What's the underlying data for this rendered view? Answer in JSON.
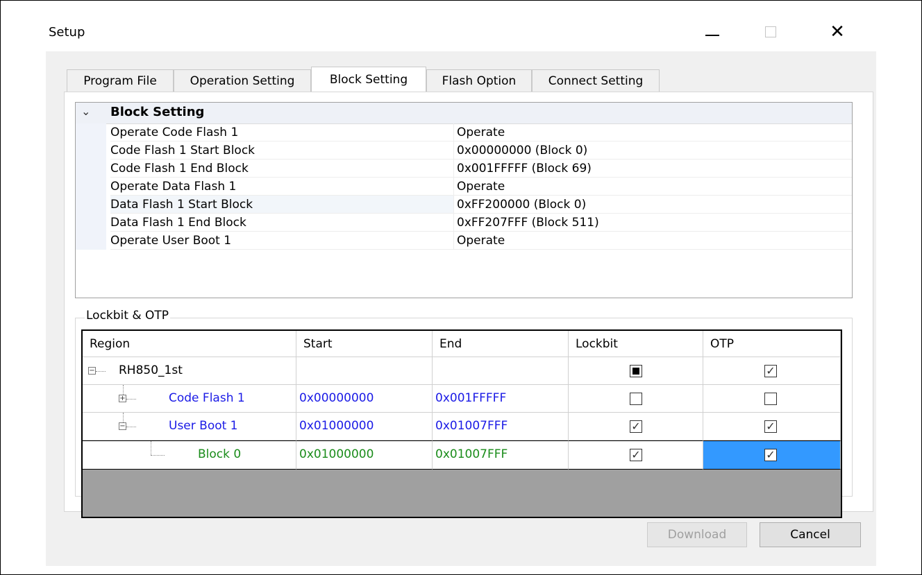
{
  "window": {
    "title": "Setup"
  },
  "tabs": [
    {
      "label": "Program File"
    },
    {
      "label": "Operation Setting"
    },
    {
      "label": "Block Setting"
    },
    {
      "label": "Flash Option"
    },
    {
      "label": "Connect Setting"
    }
  ],
  "block_setting": {
    "header": "Block Setting",
    "rows": [
      {
        "name": "Operate Code Flash 1",
        "value": "Operate"
      },
      {
        "name": "Code Flash 1 Start Block",
        "value": "0x00000000 (Block 0)"
      },
      {
        "name": "Code Flash 1 End Block",
        "value": "0x001FFFFF (Block 69)"
      },
      {
        "name": "Operate Data Flash 1",
        "value": "Operate"
      },
      {
        "name": "Data Flash 1 Start Block",
        "value": "0xFF200000 (Block 0)"
      },
      {
        "name": "Data Flash 1 End Block",
        "value": "0xFF207FFF (Block 511)"
      },
      {
        "name": "Operate User Boot 1",
        "value": "Operate"
      }
    ]
  },
  "lockbit": {
    "group_label": "Lockbit & OTP",
    "columns": [
      "Region",
      "Start",
      "End",
      "Lockbit",
      "OTP"
    ],
    "rows": [
      {
        "region": "RH850_1st",
        "start": "",
        "end": "",
        "lockbit": "indeterminate",
        "otp": "checked",
        "expander": "minus"
      },
      {
        "region": "Code Flash 1",
        "start": "0x00000000",
        "end": "0x001FFFFF",
        "lockbit": "unchecked",
        "otp": "unchecked",
        "expander": "plus"
      },
      {
        "region": "User Boot 1",
        "start": "0x01000000",
        "end": "0x01007FFF",
        "lockbit": "checked",
        "otp": "checked",
        "expander": "minus"
      },
      {
        "region": "Block 0",
        "start": "0x01000000",
        "end": "0x01007FFF",
        "lockbit": "checked",
        "otp": "checked",
        "expander": ""
      }
    ]
  },
  "buttons": {
    "download": "Download",
    "cancel": "Cancel"
  },
  "icons": {
    "collapse": "chevron-down-icon",
    "expand": "plus-box-icon",
    "collapse_tree": "minus-box-icon",
    "check": "✓"
  },
  "colors": {
    "selection": "#3399ff",
    "blue_text": "#1a1ae6",
    "green_text": "#1a8c1a"
  }
}
